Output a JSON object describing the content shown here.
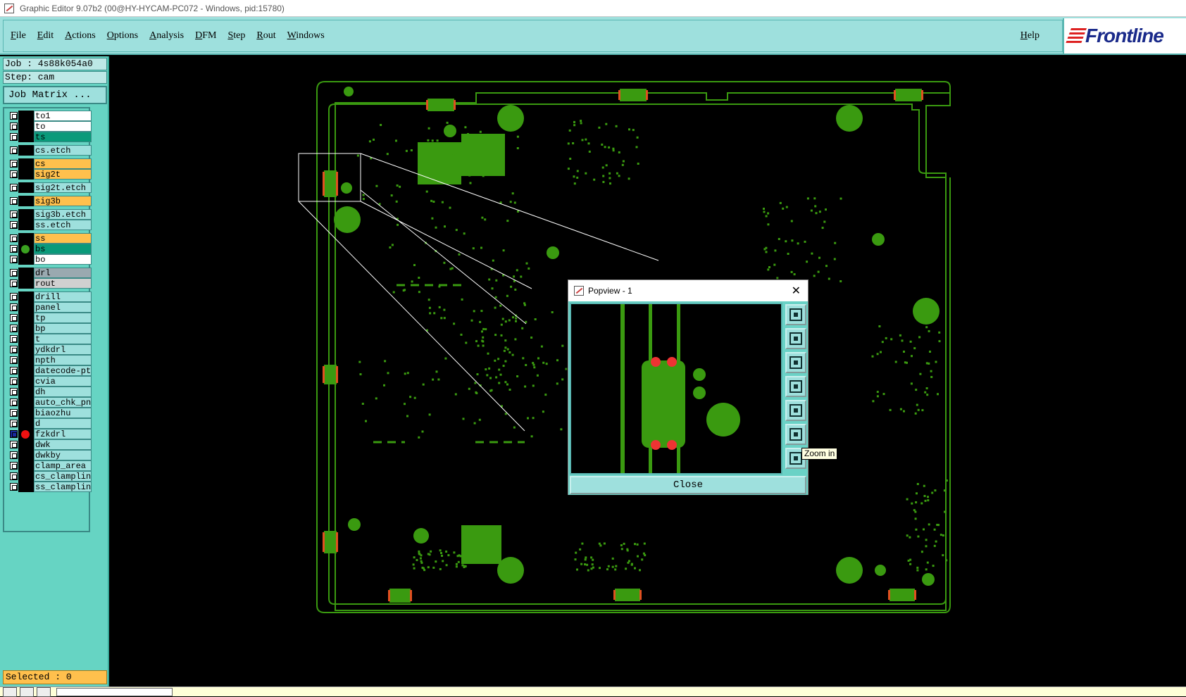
{
  "window": {
    "title": "Graphic Editor 9.07b2 (00@HY-HYCAM-PC072 - Windows, pid:15780)"
  },
  "menu": {
    "items": [
      "File",
      "Edit",
      "Actions",
      "Options",
      "Analysis",
      "DFM",
      "Step",
      "Rout",
      "Windows"
    ],
    "help": "Help",
    "logo": "Frontline"
  },
  "job": {
    "job_label": "Job : 4s88k054a0",
    "step_label": "Step: cam",
    "matrix_button": "Job Matrix ..."
  },
  "layers": [
    {
      "name": "to1",
      "color": "#ffffff"
    },
    {
      "name": "to",
      "color": "#ffffff"
    },
    {
      "name": "ts",
      "color": "#0a9a7a"
    },
    {
      "name": "cs.etch",
      "color": "#9ee0dd"
    },
    {
      "name": "cs",
      "color": "#ffc04d"
    },
    {
      "name": "sig2t",
      "color": "#ffc04d"
    },
    {
      "name": "sig2t.etch",
      "color": "#9ee0dd"
    },
    {
      "name": "sig3b",
      "color": "#ffc04d"
    },
    {
      "name": "sig3b.etch",
      "color": "#9ee0dd"
    },
    {
      "name": "ss.etch",
      "color": "#9ee0dd"
    },
    {
      "name": "ss",
      "color": "#ffc04d"
    },
    {
      "name": "bs",
      "color": "#0a9a7a",
      "dot": "#3aa020"
    },
    {
      "name": "bo",
      "color": "#ffffff"
    },
    {
      "name": "drl",
      "color": "#9aa9b0"
    },
    {
      "name": "rout",
      "color": "#d0d0d0"
    },
    {
      "name": "drill",
      "color": "#9ee0dd"
    },
    {
      "name": "panel",
      "color": "#9ee0dd"
    },
    {
      "name": "tp",
      "color": "#9ee0dd"
    },
    {
      "name": "bp",
      "color": "#9ee0dd"
    },
    {
      "name": "t",
      "color": "#9ee0dd"
    },
    {
      "name": "ydkdrl",
      "color": "#9ee0dd"
    },
    {
      "name": "npth",
      "color": "#9ee0dd"
    },
    {
      "name": "datecode-pts",
      "color": "#9ee0dd"
    },
    {
      "name": "cvia",
      "color": "#9ee0dd"
    },
    {
      "name": "dh",
      "color": "#9ee0dd"
    },
    {
      "name": "auto_chk_pnl",
      "color": "#9ee0dd"
    },
    {
      "name": "biaozhu",
      "color": "#9ee0dd"
    },
    {
      "name": "d",
      "color": "#9ee0dd"
    },
    {
      "name": "fzkdrl",
      "color": "#9ee0dd",
      "dot": "#ee1111",
      "active": true
    },
    {
      "name": "dwk",
      "color": "#9ee0dd"
    },
    {
      "name": "dwkby",
      "color": "#9ee0dd"
    },
    {
      "name": "clamp_area",
      "color": "#9ee0dd"
    },
    {
      "name": "cs_clampline",
      "color": "#9ee0dd"
    },
    {
      "name": "ss_clampline",
      "color": "#9ee0dd"
    }
  ],
  "selected": "Selected : 0",
  "popview": {
    "title": "Popview - 1",
    "close_label": "Close",
    "tooltip": "Zoom in"
  },
  "colors": {
    "pcb_green": "#3a9a10",
    "pad_orange": "#e05020",
    "menu_bg": "#9ee0dd",
    "panel_bg": "#66d4c3"
  }
}
